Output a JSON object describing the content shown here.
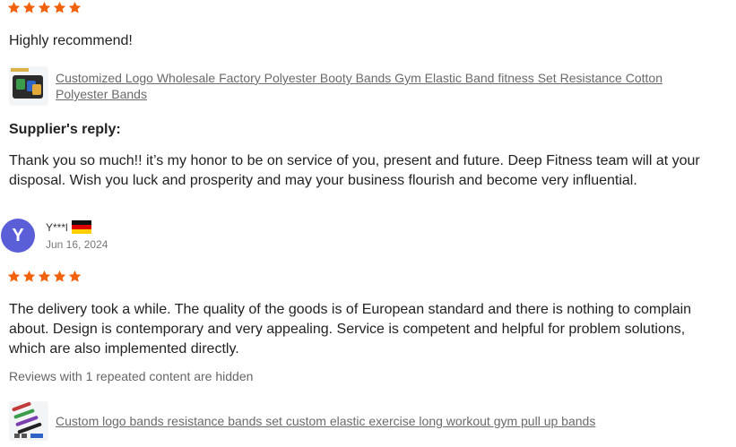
{
  "review1": {
    "rating": 5,
    "text": "Highly recommend!",
    "product_title": "Customized Logo Wholesale Factory Polyester Booty Bands Gym Elastic Band fitness Set Resistance Cotton Polyester Bands",
    "reply_label": "Supplier's reply:",
    "reply_text": "Thank you so much!! it’s my honor to be on service of you, present and future. Deep Fitness team will at your disposal. Wish you luck and prosperity and may your business flourish and become very influential."
  },
  "review2": {
    "avatar_letter": "Y",
    "username": "Y***l",
    "country_flag": "germany-flag-icon",
    "date": "Jun 16, 2024",
    "rating": 5,
    "text": "The delivery took a while. The quality of the goods is of European standard and there is nothing to complain about. Design is contemporary and very appealing. Service is competent and helpful for problem solutions, which are also implemented directly.",
    "hidden_note": "Reviews with 1 repeated content are hidden",
    "product_title": "Custom logo bands resistance bands set custom elastic exercise long workout gym pull up bands"
  },
  "colors": {
    "star": "#f2610c",
    "avatar_bg": "#5a5fd7",
    "link": "#6a6a6a"
  }
}
